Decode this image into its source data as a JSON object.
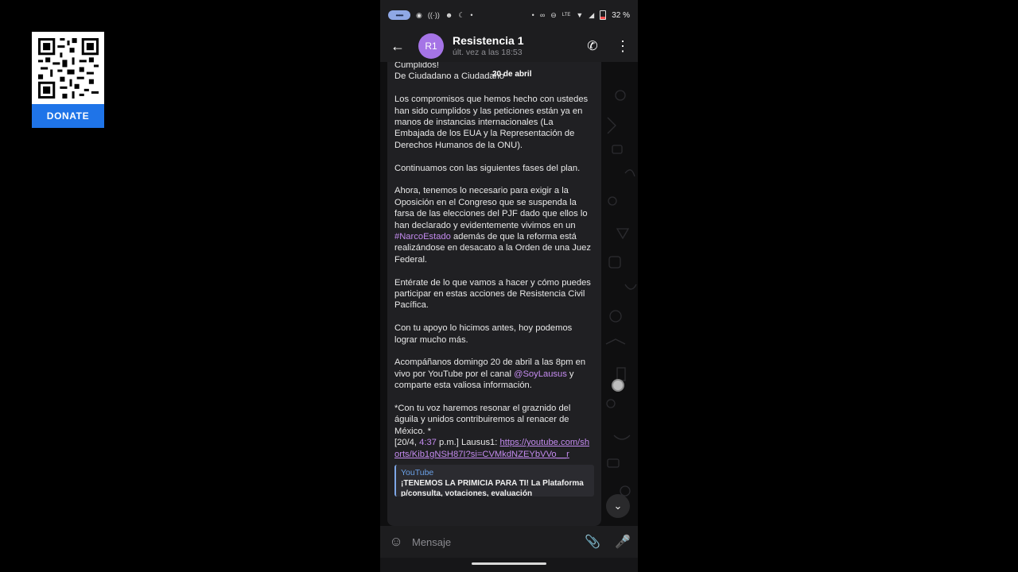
{
  "donate": {
    "label": "DONATE"
  },
  "status_bar": {
    "battery": "32 %"
  },
  "header": {
    "avatar_initials": "R1",
    "title": "Resistencia 1",
    "subtitle": "últ. vez a las 18:53"
  },
  "message": {
    "date_chip": "20 de abril",
    "line1": "Cumplidos!",
    "line2": "De Ciudadano a Ciudadano",
    "p1": "Los compromisos que hemos hecho con ustedes han sido cumplidos y las peticiones están ya en manos de instancias internacionales (La Embajada de los EUA y la Representación de Derechos Humanos de la ONU).",
    "p2": "Continuamos con las siguientes fases del plan.",
    "p3_a": "Ahora, tenemos lo necesario para exigir a la Oposición en el Congreso que se suspenda la farsa de las elecciones del PJF dado que ellos lo han declarado y evidentemente vivimos en un ",
    "p3_hashtag": "#NarcoEstado",
    "p3_b": " además de que la reforma está realizándose en desacato a la Orden de una Juez Federal.",
    "p4": "Entérate de lo que vamos a hacer y cómo puedes participar en estas acciones de Resistencia Civil Pacífica.",
    "p5": "Con tu apoyo lo hicimos antes, hoy podemos lograr mucho más.",
    "p6_a": "Acompáñanos domingo 20 de abril a las 8pm en vivo por YouTube por el canal ",
    "p6_mention": "@SoyLausus",
    "p6_b": " y comparte esta valiosa información.",
    "p7": "*Con tu voz haremos resonar el graznido del águila y unidos contribuiremos al renacer de México. *",
    "quote_prefix": "[20/4, ",
    "quote_time": "4:37",
    "quote_mid": " p.m.] Lausus1: ",
    "link": "https://youtube.com/shorts/Kib1gNSH87I?si=CVMkdNZEYbVVo__r",
    "preview_source": "YouTube",
    "preview_title": "¡TENEMOS LA PRIMICIA PARA TI! La Plataforma p/consulta, votaciones, evaluación"
  },
  "input": {
    "placeholder": "Mensaje"
  },
  "colors": {
    "accent": "#c48bf0",
    "avatar": "#a574e6",
    "donate": "#1f74e8"
  },
  "icons": [
    "back-arrow-icon",
    "phone-icon",
    "more-vert-icon",
    "emoji-icon",
    "attach-icon",
    "mic-icon",
    "chevron-down-icon"
  ]
}
